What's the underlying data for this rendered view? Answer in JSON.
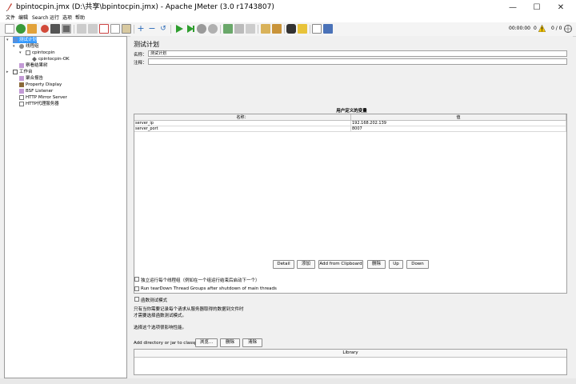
{
  "window": {
    "title": "bpintocpin.jmx (D:\\共享\\bpintocpin.jmx) - Apache JMeter (3.0 r1743807)",
    "minimize_glyph": "—",
    "maximize_glyph": "☐",
    "close_glyph": "✕"
  },
  "menu": [
    "文件",
    "编辑",
    "Search",
    "运行",
    "选项",
    "帮助"
  ],
  "toolbar": {
    "timer": "00:00:00",
    "active_threads": "0",
    "thread_ratio": "0 / 0",
    "icons": [
      "new-icon",
      "templates-icon",
      "open-icon",
      "close-icon",
      "save-icon",
      "save-as-icon",
      "undo-icon",
      "redo-icon",
      "cut-icon",
      "copy-icon",
      "paste-icon",
      "expand-icon",
      "collapse-icon",
      "toggle-icon",
      "start-icon",
      "start-no-pause-icon",
      "stop-icon",
      "shutdown-icon",
      "remote-start-icon",
      "remote-stop-icon",
      "remote-shutdown-icon",
      "clear-icon",
      "clear-all-icon",
      "search-icon",
      "reset-search-icon",
      "function-helper-icon",
      "help-icon"
    ]
  },
  "tree": {
    "nodes": [
      {
        "label": "测试计划",
        "icon": "test-plan-icon",
        "selected": true
      },
      {
        "label": "线程组",
        "icon": "thread-group-icon"
      },
      {
        "label": "cpintocpin",
        "icon": "sampler-icon"
      },
      {
        "label": "cpintocpin-OK",
        "icon": "assertion-icon"
      },
      {
        "label": "察看结果树",
        "icon": "listener-icon"
      },
      {
        "label": "工作台",
        "icon": "workbench-icon"
      },
      {
        "label": "聚合报告",
        "icon": "listener-icon"
      },
      {
        "label": "Property Display",
        "icon": "property-icon"
      },
      {
        "label": "BSF Listener",
        "icon": "listener-icon"
      },
      {
        "label": "HTTP Mirror Server",
        "icon": "server-icon"
      },
      {
        "label": "HTTP代理服务器",
        "icon": "server-icon"
      }
    ]
  },
  "panel": {
    "title": "测试计划",
    "name_label": "名称：",
    "name_value": "测试计划",
    "comment_label": "注释：",
    "comment_value": "",
    "vars_heading": "用户定义的变量",
    "columns": [
      "名称：",
      "值"
    ],
    "rows": [
      {
        "name": "server_ip",
        "value": "192.168.202.139"
      },
      {
        "name": "server_port",
        "value": "8007"
      }
    ],
    "buttons": [
      "Detail",
      "添加",
      "Add from Clipboard",
      "删除",
      "Up",
      "Down"
    ],
    "check_serialize": "独立运行每个线程组（例如在一个组运行结束后启动下一个）",
    "check_teardown": "Run tearDown Thread Groups after shutdown of main threads",
    "check_functional": "函数测试模式",
    "functional_note_1": "只有当你需要记录每个请求从服务器取得的数据到文件时",
    "functional_note_2": "才需要选择函数测试模式。",
    "select_note": "选择这个选项很影响性能。",
    "classpath_label": "Add directory or jar to classpath",
    "browse_label": "浏览...",
    "delete_label": "删除",
    "clear_label": "清除",
    "library_header": "Library"
  },
  "colors": {
    "selected_bg": "#3399ff",
    "start_green": "#2e9e2e",
    "stop_gray": "#9a9a9a"
  }
}
